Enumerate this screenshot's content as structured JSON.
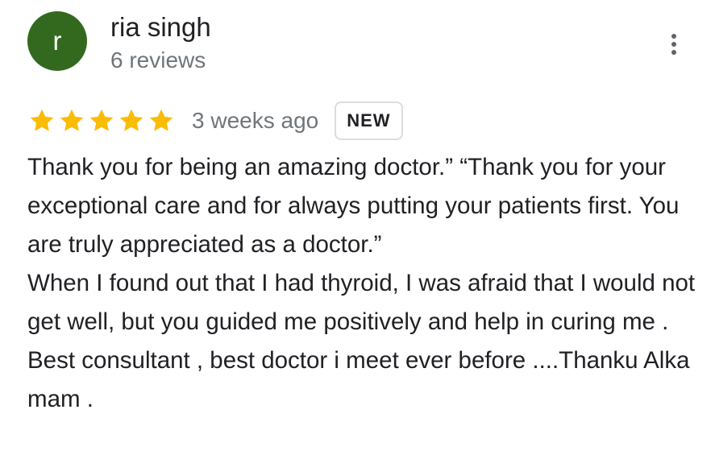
{
  "reviewer": {
    "initial": "r",
    "avatar_color": "#33691e",
    "name": "ria singh",
    "review_count": "6 reviews"
  },
  "menu": {
    "icon": "more-vert-icon"
  },
  "review": {
    "rating": 5,
    "rating_max": 5,
    "star_color": "#fbbc04",
    "time_ago": "3 weeks ago",
    "badge": "NEW",
    "text": "Thank you for being an amazing doctor.” “Thank you for your exceptional care and for always putting your patients first. You are truly appreciated as a doctor.”\nWhen I found out that I had thyroid, I was afraid that I would not get well, but you guided me positively and help in curing me . Best consultant , best doctor i meet ever before ....Thanku Alka mam ."
  }
}
